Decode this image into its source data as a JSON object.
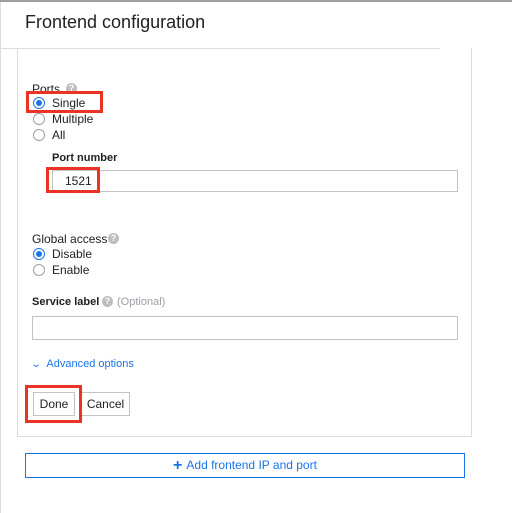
{
  "header": {
    "title": "Frontend configuration"
  },
  "ports": {
    "label": "Ports",
    "options": [
      "Single",
      "Multiple",
      "All"
    ],
    "selected": "Single",
    "port_number_label": "Port number",
    "port_number_value": "1521"
  },
  "global_access": {
    "label": "Global access",
    "options": [
      "Disable",
      "Enable"
    ],
    "selected": "Disable"
  },
  "service_label": {
    "label": "Service label",
    "optional_text": "(Optional)",
    "value": ""
  },
  "advanced_options": {
    "label": "Advanced options"
  },
  "actions": {
    "done_label": "Done",
    "cancel_label": "Cancel"
  },
  "add_frontend": {
    "label": "Add frontend IP and port"
  },
  "colors": {
    "accent": "#1a73e8",
    "highlight": "#ea3323"
  }
}
